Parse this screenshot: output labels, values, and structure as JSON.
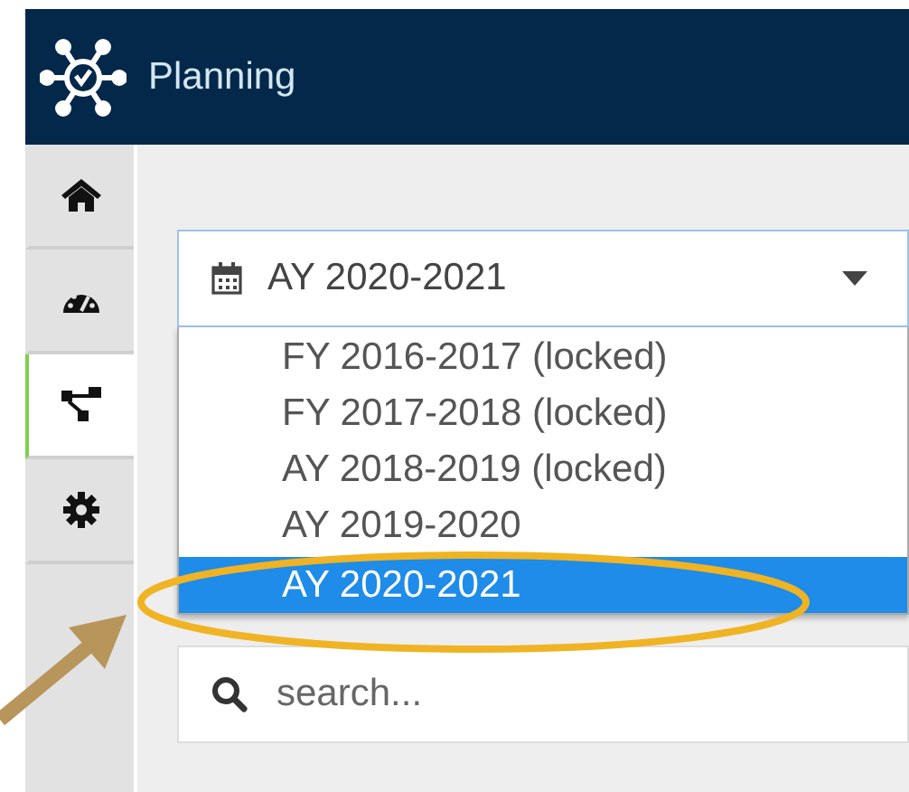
{
  "app": {
    "title": "Planning"
  },
  "sidebar": {
    "items": [
      {
        "kind": "home",
        "selected": false
      },
      {
        "kind": "dashboard",
        "selected": false
      },
      {
        "kind": "sitemap",
        "selected": true
      },
      {
        "kind": "settings",
        "selected": false
      }
    ]
  },
  "year_select": {
    "value": "AY 2020-2021",
    "options": [
      {
        "label": "FY 2016-2017 (locked)",
        "selected": false
      },
      {
        "label": "FY 2017-2018 (locked)",
        "selected": false
      },
      {
        "label": "AY 2018-2019 (locked)",
        "selected": false
      },
      {
        "label": "AY 2019-2020",
        "selected": false
      },
      {
        "label": "AY 2020-2021",
        "selected": true
      }
    ]
  },
  "search": {
    "placeholder": "search..."
  }
}
